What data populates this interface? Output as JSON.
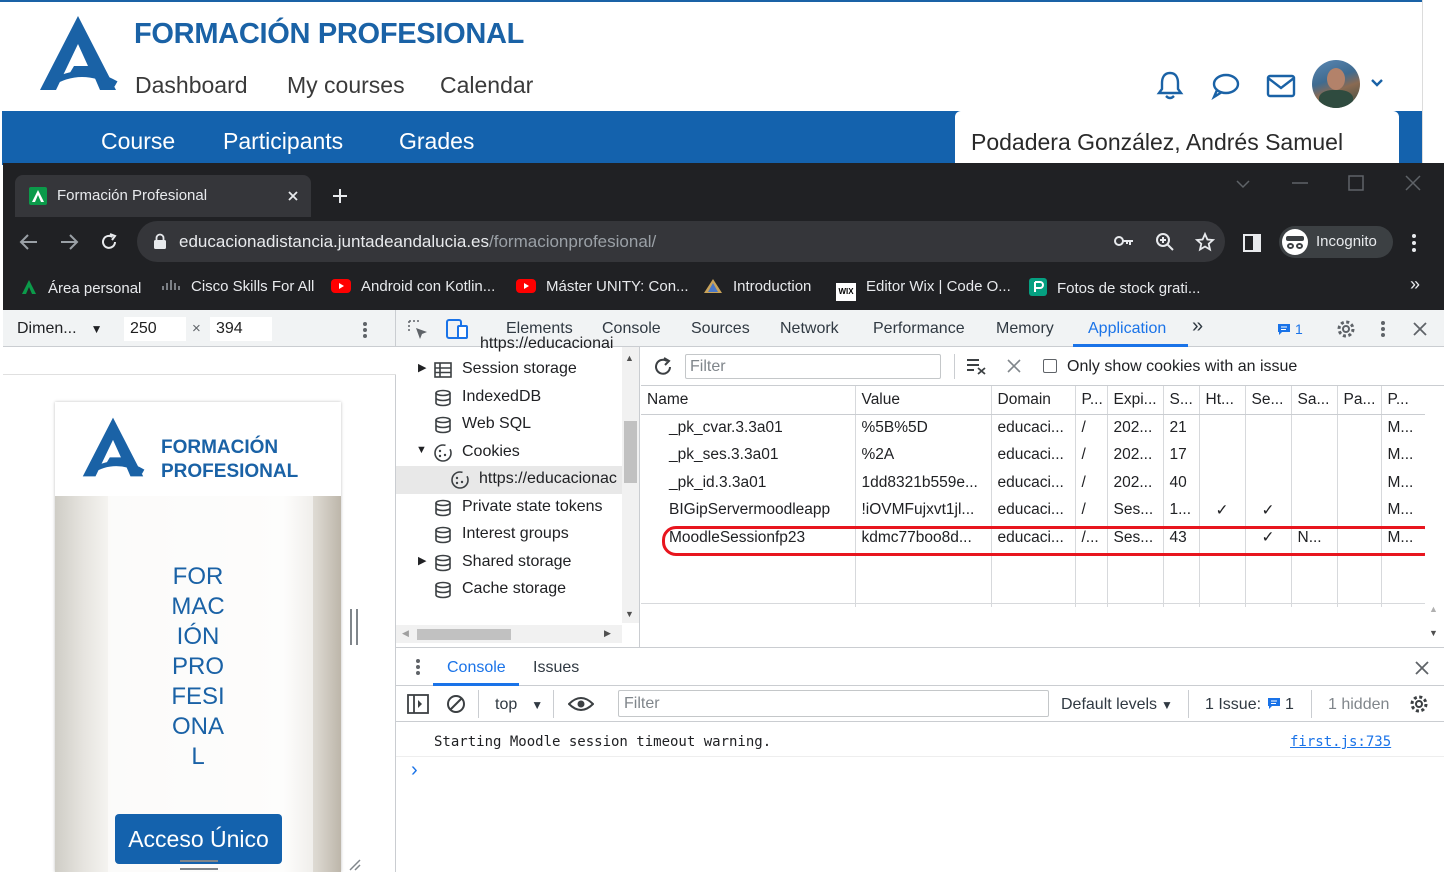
{
  "moodle": {
    "title": "FORMACIÓN PROFESIONAL",
    "nav": [
      "Dashboard",
      "My courses",
      "Calendar"
    ],
    "course_nav": [
      "Course",
      "Participants",
      "Grades"
    ],
    "user_name": "Podadera González, Andrés Samuel"
  },
  "browser": {
    "tab_title": "Formación Profesional",
    "url_host": "educacionadistancia.juntadeandalucia.es",
    "url_path": "/formacionprofesional/",
    "incognito_label": "Incognito",
    "bookmarks": [
      "Área personal",
      "Cisco Skills For All",
      "Android con Kotlin...",
      "Máster UNITY: Con...",
      "Introduction",
      "Editor Wix | Code O...",
      "Fotos de stock grati..."
    ],
    "bookmarks_more": "»"
  },
  "devtools": {
    "device_label": "Dimen...",
    "width": "250",
    "times": "×",
    "height": "394",
    "tabs": [
      "Elements",
      "Console",
      "Sources",
      "Network",
      "Performance",
      "Memory",
      "Application"
    ],
    "more_tabs": "»",
    "issues_count": "1",
    "tree": {
      "partial_top": "https://educacionai",
      "items": [
        "Session storage",
        "IndexedDB",
        "Web SQL",
        "Cookies",
        "https://educacionac",
        "Private state tokens",
        "Interest groups",
        "Shared storage",
        "Cache storage"
      ]
    },
    "cookies": {
      "filter_placeholder": "Filter",
      "only_issue_label": "Only show cookies with an issue",
      "columns": [
        "Name",
        "Value",
        "Domain",
        "P...",
        "Expi...",
        "S...",
        "Ht...",
        "Se...",
        "Sa...",
        "Pa...",
        "P..."
      ],
      "rows": [
        [
          "_pk_cvar.3.3a01",
          "%5B%5D",
          "educaci...",
          "/",
          "202...",
          "21",
          "",
          "",
          "",
          "",
          "M..."
        ],
        [
          "_pk_ses.3.3a01",
          "%2A",
          "educaci...",
          "/",
          "202...",
          "17",
          "",
          "",
          "",
          "",
          "M..."
        ],
        [
          "_pk_id.3.3a01",
          "1dd8321b559e...",
          "educaci...",
          "/",
          "202...",
          "40",
          "",
          "",
          "",
          "",
          "M..."
        ],
        [
          "BIGipServermoodleapp",
          "!iOVMFujxvt1jl...",
          "educaci...",
          "/",
          "Ses...",
          "1...",
          "✓",
          "✓",
          "",
          "",
          "M..."
        ],
        [
          "MoodleSessionfp23",
          "kdmc77boo8d...",
          "educaci...",
          "/...",
          "Ses...",
          "43",
          "",
          "✓",
          "N...",
          "",
          "M..."
        ]
      ],
      "highlight_color": "#e8151e"
    },
    "console": {
      "tabs": [
        "Console",
        "Issues"
      ],
      "context": "top",
      "filter_placeholder": "Filter",
      "levels": "Default levels",
      "issue_label": "1 Issue:",
      "issue_count": "1",
      "hidden": "1 hidden",
      "message": "Starting Moodle session timeout warning.",
      "source": "first.js:735",
      "prompt": "›"
    },
    "preview": {
      "logo_line1": "FORMACIÓN",
      "logo_line2": "PROFESIONAL",
      "banner_lines": [
        "FOR",
        "MAC",
        "IÓN",
        "PRO",
        "FESI",
        "ONA",
        "L"
      ],
      "button": "Acceso Único"
    }
  }
}
